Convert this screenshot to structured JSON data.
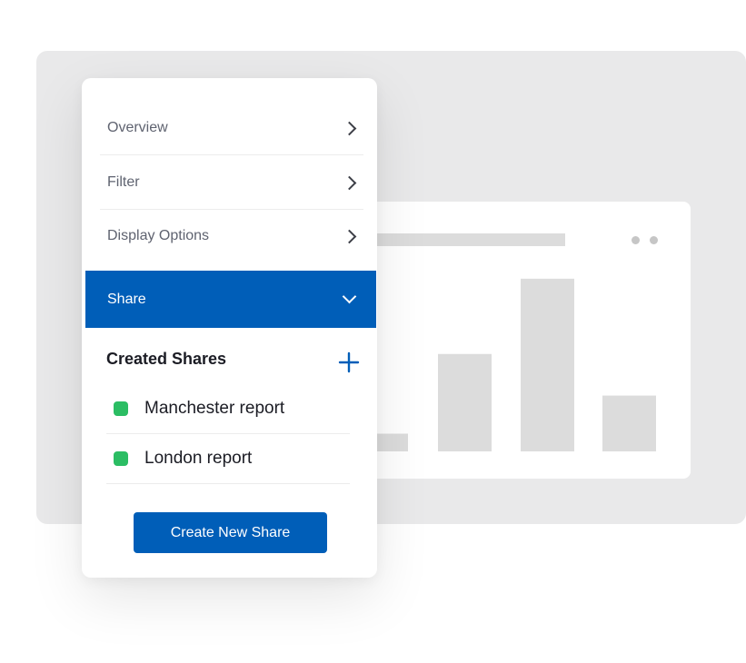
{
  "menu": {
    "items": [
      {
        "label": "Overview"
      },
      {
        "label": "Filter"
      },
      {
        "label": "Display Options"
      }
    ],
    "active": {
      "label": "Share"
    }
  },
  "shares": {
    "title": "Created Shares",
    "list": [
      {
        "name": "Manchester report",
        "status_color": "#2bbd63"
      },
      {
        "name": "London report",
        "status_color": "#2bbd63"
      }
    ],
    "create_label": "Create New Share"
  },
  "colors": {
    "accent": "#005eb8",
    "status_active": "#2bbd63",
    "placeholder_bar": "#dcdcdc"
  },
  "chart_data": {
    "type": "bar",
    "categories": [
      "",
      "",
      "",
      ""
    ],
    "values": [
      2,
      11,
      19.5,
      6.3
    ],
    "ylim": [
      0,
      20
    ],
    "title": "",
    "xlabel": "",
    "ylabel": "",
    "grid": false
  }
}
